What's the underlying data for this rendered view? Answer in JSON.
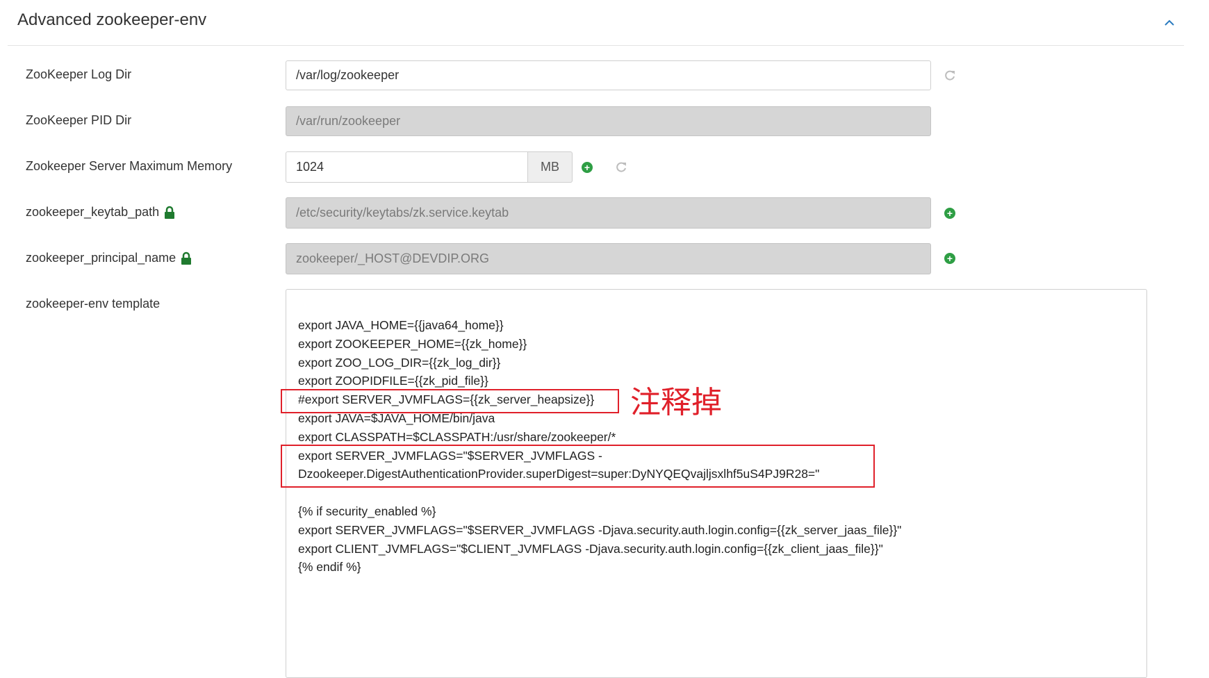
{
  "section": {
    "title": "Advanced zookeeper-env"
  },
  "fields": {
    "log_dir": {
      "label": "ZooKeeper Log Dir",
      "value": "/var/log/zookeeper"
    },
    "pid_dir": {
      "label": "ZooKeeper PID Dir",
      "value": "/var/run/zookeeper"
    },
    "max_memory": {
      "label": "Zookeeper Server Maximum Memory",
      "value": "1024",
      "unit": "MB"
    },
    "keytab_path": {
      "label": "zookeeper_keytab_path",
      "value": "/etc/security/keytabs/zk.service.keytab"
    },
    "principal_name": {
      "label": "zookeeper_principal_name",
      "value": "zookeeper/_HOST@DEVDIP.ORG"
    },
    "template": {
      "label": "zookeeper-env template",
      "content": "export JAVA_HOME={{java64_home}}\nexport ZOOKEEPER_HOME={{zk_home}}\nexport ZOO_LOG_DIR={{zk_log_dir}}\nexport ZOOPIDFILE={{zk_pid_file}}\n#export SERVER_JVMFLAGS={{zk_server_heapsize}}\nexport JAVA=$JAVA_HOME/bin/java\nexport CLASSPATH=$CLASSPATH:/usr/share/zookeeper/*\nexport SERVER_JVMFLAGS=\"$SERVER_JVMFLAGS -\nDzookeeper.DigestAuthenticationProvider.superDigest=super:DyNYQEQvajljsxlhf5uS4PJ9R28=\"\n\n{% if security_enabled %}\nexport SERVER_JVMFLAGS=\"$SERVER_JVMFLAGS -Djava.security.auth.login.config={{zk_server_jaas_file}}\"\nexport CLIENT_JVMFLAGS=\"$CLIENT_JVMFLAGS -Djava.security.auth.login.config={{zk_client_jaas_file}}\"\n{% endif %}"
    }
  },
  "annotation": {
    "text": "注释掉"
  },
  "icons": {
    "collapse": "chevron-up-icon",
    "refresh": "refresh-icon",
    "add": "plus-circle-icon",
    "lock": "lock-icon"
  },
  "colors": {
    "accent_green": "#2e9e44",
    "annotation_red": "#e0202a",
    "readonly_bg": "#d6d6d6"
  }
}
